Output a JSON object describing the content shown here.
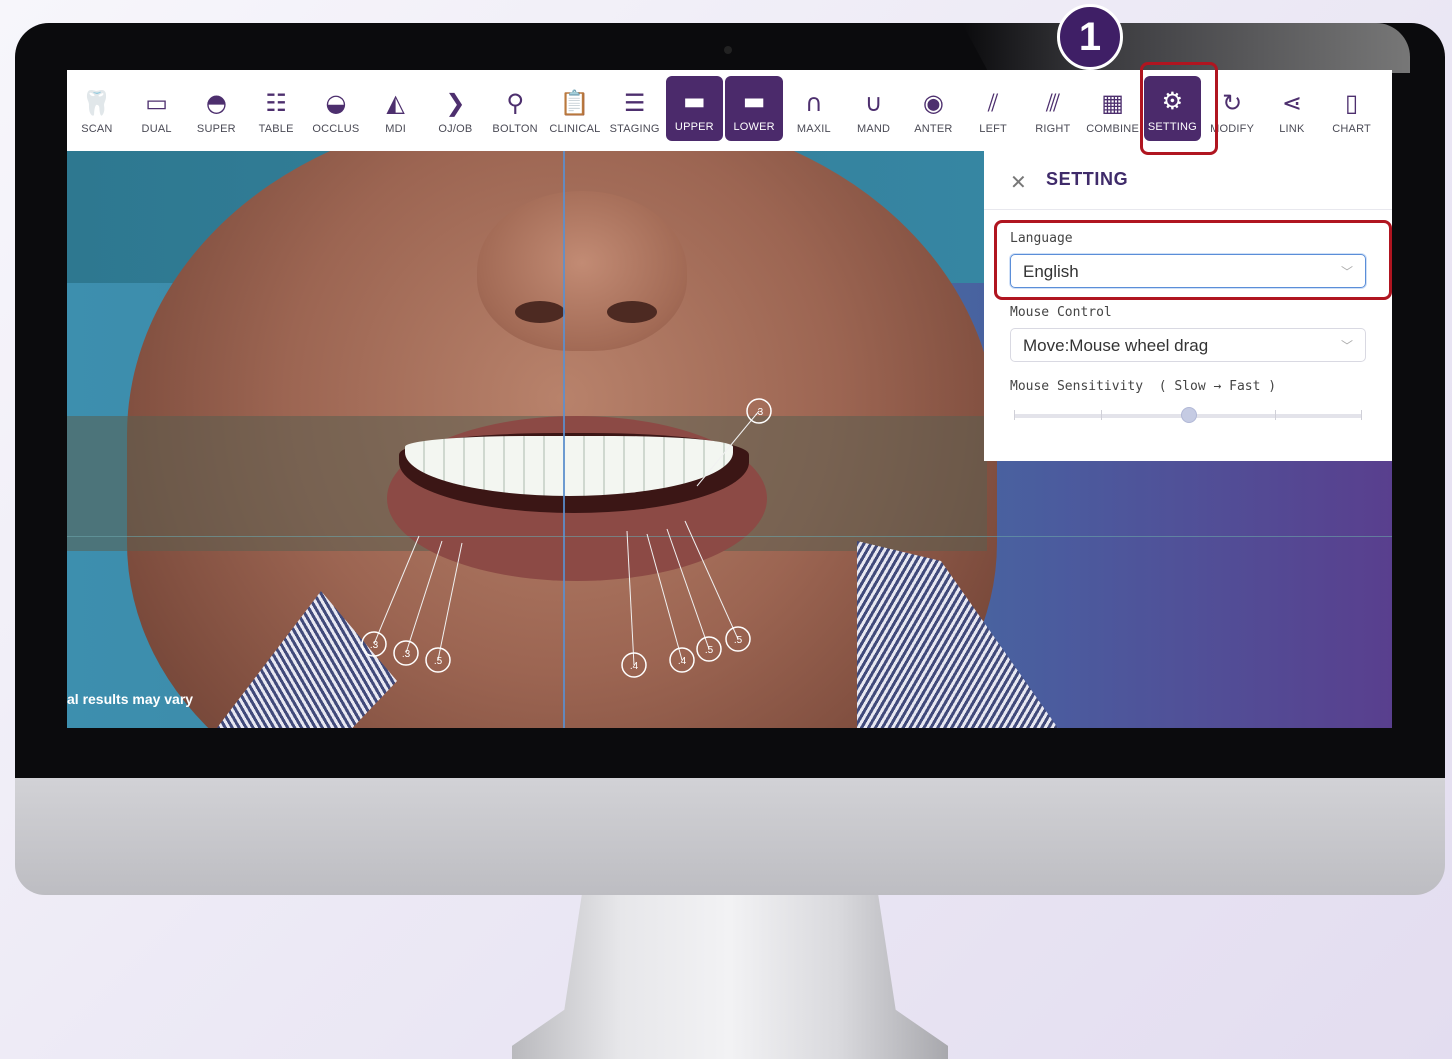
{
  "toolbar": {
    "items": [
      {
        "label": "SCAN",
        "icon": "scan-tooth-icon"
      },
      {
        "label": "DUAL",
        "icon": "dual-monitor-icon"
      },
      {
        "label": "SUPER",
        "icon": "superimpose-icon"
      },
      {
        "label": "TABLE",
        "icon": "table-icon"
      },
      {
        "label": "OCCLUS",
        "icon": "occlusion-icon"
      },
      {
        "label": "MDI",
        "icon": "mdi-icon"
      },
      {
        "label": "OJ/OB",
        "icon": "ojob-icon"
      },
      {
        "label": "BOLTON",
        "icon": "bolton-tooth-icon"
      },
      {
        "label": "CLINICAL",
        "icon": "clipboard-icon"
      },
      {
        "label": "STAGING",
        "icon": "staging-lines-icon"
      },
      {
        "label": "UPPER",
        "icon": "upper-arch-icon",
        "active": true
      },
      {
        "label": "LOWER",
        "icon": "lower-arch-icon",
        "active": true
      },
      {
        "label": "MAXIL",
        "icon": "maxillary-icon"
      },
      {
        "label": "MAND",
        "icon": "mandibular-icon"
      },
      {
        "label": "ANTER",
        "icon": "anterior-icon"
      },
      {
        "label": "LEFT",
        "icon": "left-view-icon"
      },
      {
        "label": "RIGHT",
        "icon": "right-view-icon"
      },
      {
        "label": "COMBINE",
        "icon": "combine-icon"
      },
      {
        "label": "SETTING",
        "icon": "gears-icon",
        "active": true
      },
      {
        "label": "MODIFY",
        "icon": "refresh-icon"
      },
      {
        "label": "LINK",
        "icon": "share-icon"
      },
      {
        "label": "CHART",
        "icon": "tooth-chart-icon"
      }
    ]
  },
  "step_badge": "1",
  "viewport": {
    "disclaimer": "al results may vary",
    "annotations": [
      ".3",
      ".3",
      ".3",
      ".5",
      ".4",
      ".4",
      ".5",
      ".5"
    ]
  },
  "settings": {
    "title": "SETTING",
    "language_label": "Language",
    "language_value": "English",
    "mouse_control_label": "Mouse Control",
    "mouse_control_value": "Move:Mouse wheel drag",
    "sensitivity_label": "Mouse Sensitivity  ( Slow → Fast )",
    "sensitivity_level": 0.5
  },
  "colors": {
    "accent": "#4b2a6b",
    "highlight": "#b01520"
  }
}
